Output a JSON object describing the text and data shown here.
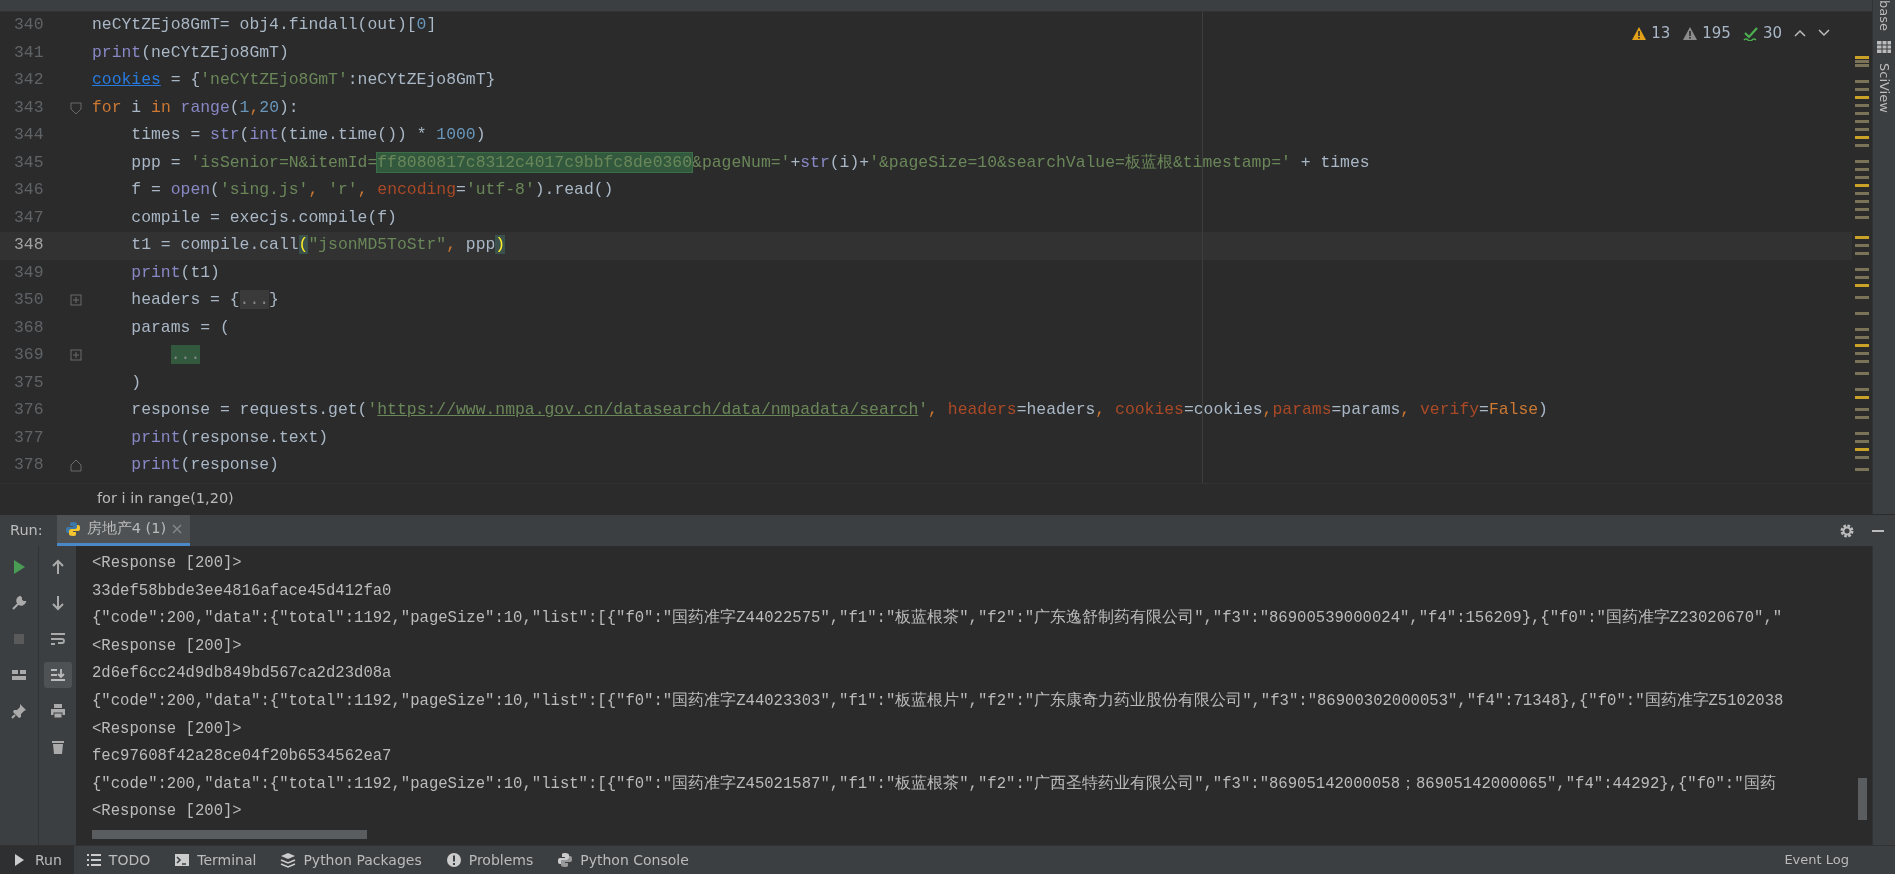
{
  "editor": {
    "inspections": [
      {
        "kind": "warning",
        "count": "13"
      },
      {
        "kind": "weak-warning",
        "count": "195"
      },
      {
        "kind": "typo",
        "count": "30"
      }
    ],
    "lines": [
      {
        "number": "340",
        "current": false,
        "kind": "plain",
        "tokens": [
          {
            "text": "neCYtZEjo8GmT= obj4.findall(out)[",
            "kind": "plain"
          },
          {
            "text": "0",
            "kind": "num"
          },
          {
            "text": "]",
            "kind": "plain"
          }
        ]
      },
      {
        "number": "341",
        "current": false,
        "kind": "plain",
        "tokens": [
          {
            "text": "print",
            "kind": "builtin"
          },
          {
            "text": "(neCYtZEjo8GmT)",
            "kind": "plain"
          }
        ]
      },
      {
        "number": "342",
        "current": false,
        "kind": "plain",
        "tokens": [
          {
            "text": "cookies",
            "kind": "link"
          },
          {
            "text": " = {",
            "kind": "plain"
          },
          {
            "text": "'neCYtZEjo8GmT'",
            "kind": "str"
          },
          {
            "text": ":neCYtZEjo8GmT}",
            "kind": "plain"
          }
        ]
      },
      {
        "number": "343",
        "current": false,
        "kind": "start",
        "tokens": [
          {
            "text": "for",
            "kind": "kw"
          },
          {
            "text": " i ",
            "kind": "plain"
          },
          {
            "text": "in",
            "kind": "kw"
          },
          {
            "text": " range",
            "kind": "builtin"
          },
          {
            "text": "(",
            "kind": "plain"
          },
          {
            "text": "1",
            "kind": "num"
          },
          {
            "text": ",",
            "kind": "kw"
          },
          {
            "text": "20",
            "kind": "num"
          },
          {
            "text": "):",
            "kind": "plain"
          }
        ]
      },
      {
        "number": "344",
        "current": false,
        "kind": "plain",
        "tokens": [
          {
            "text": "    times = ",
            "kind": "plain"
          },
          {
            "text": "str",
            "kind": "builtin"
          },
          {
            "text": "(",
            "kind": "plain"
          },
          {
            "text": "int",
            "kind": "builtin"
          },
          {
            "text": "(time.time()) * ",
            "kind": "plain"
          },
          {
            "text": "1000",
            "kind": "num"
          },
          {
            "text": ")",
            "kind": "plain"
          }
        ]
      },
      {
        "number": "345",
        "current": false,
        "kind": "plain",
        "tokens": [
          {
            "text": "    ppp = ",
            "kind": "plain"
          },
          {
            "text": "'isSenior=N&itemId=",
            "kind": "str"
          },
          {
            "text": "ff8080817c8312c4017c9bbfc8de0360",
            "kind": "match"
          },
          {
            "text": "&pageNum='",
            "kind": "str"
          },
          {
            "text": "+",
            "kind": "plain"
          },
          {
            "text": "str",
            "kind": "builtin"
          },
          {
            "text": "(i)+",
            "kind": "plain"
          },
          {
            "text": "'&pageSize=10&searchValue=板蓝根&timestamp='",
            "kind": "str"
          },
          {
            "text": " + times",
            "kind": "plain"
          }
        ]
      },
      {
        "number": "346",
        "current": false,
        "kind": "plain",
        "tokens": [
          {
            "text": "    f = ",
            "kind": "plain"
          },
          {
            "text": "open",
            "kind": "builtin"
          },
          {
            "text": "(",
            "kind": "plain"
          },
          {
            "text": "'sing.js'",
            "kind": "str"
          },
          {
            "text": ", ",
            "kind": "kw"
          },
          {
            "text": "'r'",
            "kind": "str"
          },
          {
            "text": ", ",
            "kind": "kw"
          },
          {
            "text": "encoding",
            "kind": "param"
          },
          {
            "text": "=",
            "kind": "plain"
          },
          {
            "text": "'utf-8'",
            "kind": "str"
          },
          {
            "text": ").read()",
            "kind": "plain"
          }
        ]
      },
      {
        "number": "347",
        "current": false,
        "kind": "plain",
        "tokens": [
          {
            "text": "    compile = execjs.compile(f)",
            "kind": "plain"
          }
        ]
      },
      {
        "number": "348",
        "current": true,
        "kind": "plain",
        "tokens": [
          {
            "text": "    t1 = compile.call",
            "kind": "plain"
          },
          {
            "text": "(",
            "kind": "brace"
          },
          {
            "text": "\"jsonMD5ToStr\"",
            "kind": "str"
          },
          {
            "text": ", ",
            "kind": "kw"
          },
          {
            "text": "ppp",
            "kind": "plain"
          },
          {
            "text": ")",
            "kind": "brace"
          }
        ]
      },
      {
        "number": "349",
        "current": false,
        "kind": "plain",
        "tokens": [
          {
            "text": "    print",
            "kind": "builtin"
          },
          {
            "text": "(t1)",
            "kind": "plain"
          }
        ]
      },
      {
        "number": "350",
        "current": false,
        "kind": "collapsed",
        "tokens": [
          {
            "text": "    headers = {",
            "kind": "plain"
          },
          {
            "text": "...",
            "kind": "folded"
          },
          {
            "text": "}",
            "kind": "plain"
          }
        ]
      },
      {
        "number": "368",
        "current": false,
        "kind": "plain",
        "tokens": [
          {
            "text": "    params = (",
            "kind": "plain"
          }
        ]
      },
      {
        "number": "369",
        "current": false,
        "kind": "collapsed",
        "tokens": [
          {
            "text": "        ...",
            "kind": "foldedgreen"
          }
        ]
      },
      {
        "number": "375",
        "current": false,
        "kind": "plain",
        "tokens": [
          {
            "text": "    )",
            "kind": "plain"
          }
        ]
      },
      {
        "number": "376",
        "current": false,
        "kind": "plain",
        "tokens": [
          {
            "text": "    response = requests.get(",
            "kind": "plain"
          },
          {
            "text": "'",
            "kind": "str"
          },
          {
            "text": "https://www.nmpa.gov.cn/datasearch/data/nmpadata/search",
            "kind": "url"
          },
          {
            "text": "'",
            "kind": "str"
          },
          {
            "text": ", ",
            "kind": "kw"
          },
          {
            "text": "headers",
            "kind": "param"
          },
          {
            "text": "=headers",
            "kind": "plain"
          },
          {
            "text": ", ",
            "kind": "kw"
          },
          {
            "text": "cookies",
            "kind": "param"
          },
          {
            "text": "=cookies",
            "kind": "plain"
          },
          {
            "text": ",",
            "kind": "kw"
          },
          {
            "text": "params",
            "kind": "param"
          },
          {
            "text": "=params",
            "kind": "plain"
          },
          {
            "text": ", ",
            "kind": "kw"
          },
          {
            "text": "verify",
            "kind": "param"
          },
          {
            "text": "=",
            "kind": "plain"
          },
          {
            "text": "False",
            "kind": "kw"
          },
          {
            "text": ")",
            "kind": "plain"
          }
        ]
      },
      {
        "number": "377",
        "current": false,
        "kind": "plain",
        "tokens": [
          {
            "text": "    print",
            "kind": "builtin"
          },
          {
            "text": "(response.text)",
            "kind": "plain"
          }
        ]
      },
      {
        "number": "378",
        "current": false,
        "kind": "end",
        "tokens": [
          {
            "text": "    print",
            "kind": "builtin"
          },
          {
            "text": "(response)",
            "kind": "plain"
          }
        ]
      }
    ],
    "breadcrumb": "for i in range(1,20)"
  },
  "side_tabs": [
    "base",
    "SciView"
  ],
  "run_panel": {
    "label": "Run:",
    "tabs": [
      {
        "label": "房地产4 (1)",
        "selected": true
      }
    ],
    "output": [
      "<Response [200]>",
      "33def58bbde3ee4816aface45d412fa0",
      "{\"code\":200,\"data\":{\"total\":1192,\"pageSize\":10,\"list\":[{\"f0\":\"国药准字Z44022575\",\"f1\":\"板蓝根茶\",\"f2\":\"广东逸舒制药有限公司\",\"f3\":\"86900539000024\",\"f4\":156209},{\"f0\":\"国药准字Z23020670\",\"",
      "<Response [200]>",
      "2d6ef6cc24d9db849bd567ca2d23d08a",
      "{\"code\":200,\"data\":{\"total\":1192,\"pageSize\":10,\"list\":[{\"f0\":\"国药准字Z44023303\",\"f1\":\"板蓝根片\",\"f2\":\"广东康奇力药业股份有限公司\",\"f3\":\"86900302000053\",\"f4\":71348},{\"f0\":\"国药准字Z5102038",
      "<Response [200]>",
      "fec97608f42a28ce04f20b6534562ea7",
      "{\"code\":200,\"data\":{\"total\":1192,\"pageSize\":10,\"list\":[{\"f0\":\"国药准字Z45021587\",\"f1\":\"板蓝根茶\",\"f2\":\"广西圣特药业有限公司\",\"f3\":\"86905142000058；86905142000065\",\"f4\":44292},{\"f0\":\"国药",
      "<Response [200]>"
    ]
  },
  "tool_windows": [
    {
      "kind": "run",
      "label": "Run",
      "selected": true
    },
    {
      "kind": "todo",
      "label": "TODO",
      "selected": false
    },
    {
      "kind": "terminal",
      "label": "Terminal",
      "selected": false
    },
    {
      "kind": "packages",
      "label": "Python Packages",
      "selected": false
    },
    {
      "kind": "problems",
      "label": "Problems",
      "selected": false
    },
    {
      "kind": "console",
      "label": "Python Console",
      "selected": false
    }
  ],
  "event_log": "Event Log"
}
